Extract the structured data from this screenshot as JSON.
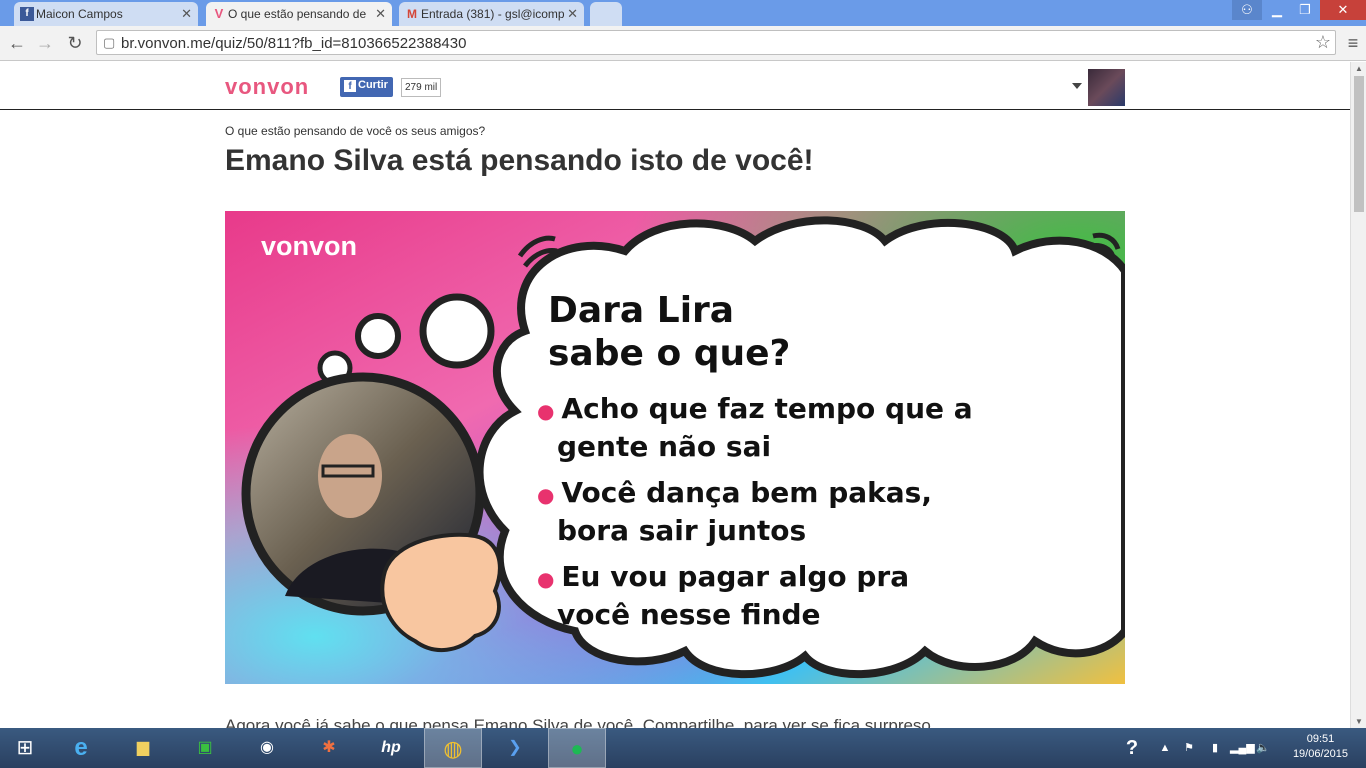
{
  "browser": {
    "tabs": [
      {
        "title": "Maicon Campos",
        "icon": "facebook-icon",
        "active": false
      },
      {
        "title": "O que estão pensando de",
        "icon": "vonvon-v-icon",
        "active": true
      },
      {
        "title": "Entrada (381) - gsl@icomp",
        "icon": "gmail-icon",
        "active": false
      }
    ],
    "url": "br.vonvon.me/quiz/50/811?fb_id=810366522388430"
  },
  "site": {
    "logo": "vonvon",
    "like_label": "Curtir",
    "like_count": "279 mil"
  },
  "quiz": {
    "subtitle": "O que estão pensando de você os seus amigos?",
    "title": "Emano Silva está pensando isto de você!",
    "image": {
      "logo": "vonvon",
      "name_line1": "Dara Lira",
      "name_line2": "sabe o que?",
      "bullets": [
        {
          "line1": "Acho que faz tempo que a",
          "line2": "gente não sai"
        },
        {
          "line1": "Você dança bem pakas,",
          "line2": "bora sair juntos"
        },
        {
          "line1": "Eu vou pagar algo pra",
          "line2": "você nesse finde"
        }
      ]
    },
    "share_text": "Agora você já sabe o que pensa Emano Silva de você. Compartilhe, para ver se fica surpreso"
  },
  "taskbar": {
    "apps": [
      "start-icon",
      "internet-explorer-icon",
      "file-explorer-icon",
      "store-icon",
      "camera-app-icon",
      "photo-app-icon",
      "hp-icon",
      "chrome-icon",
      "powershell-icon",
      "spotify-icon"
    ],
    "time": "09:51",
    "date": "19/06/2015"
  },
  "colors": {
    "brand": "#e8577f",
    "facebook": "#4267b2",
    "bullet": "#e8326e"
  }
}
